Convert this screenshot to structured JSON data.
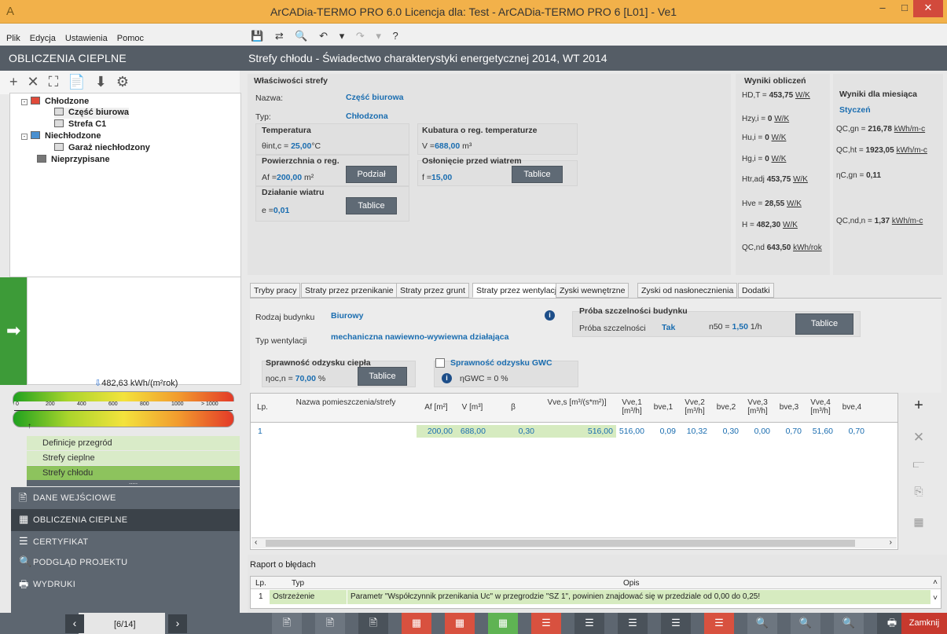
{
  "window": {
    "title": "ArCADia-TERMO PRO 6.0 Licencja dla: Test - ArCADia-TERMO PRO 6 [L01] - Ve1",
    "minimize": "–",
    "maximize": "□",
    "close": "✕"
  },
  "menu": [
    "Plik",
    "Edycja",
    "Ustawienia",
    "Pomoc"
  ],
  "quicktools": [
    "💾",
    "⇄",
    "🔍",
    "↶",
    "▾",
    "↷",
    "▾",
    "?"
  ],
  "left": {
    "header": "OBLICZENIA CIEPLNE",
    "tools": [
      "+",
      "✕",
      "⛶",
      "📄",
      "⬇",
      "⚙"
    ],
    "tree": [
      {
        "label": "Chłodzone",
        "bold": true
      },
      {
        "label": "Część biurowa",
        "bold": true
      },
      {
        "label": "Strefa C1"
      },
      {
        "label": "Niechłodzone"
      },
      {
        "label": "Garaż niechłodzony"
      },
      {
        "label": "Nieprzypisane"
      }
    ],
    "energy": "482,63 kWh/(m²rok)",
    "scale_ticks": [
      "0",
      "200",
      "400",
      "600",
      "800",
      "1000",
      "> 1000"
    ],
    "nav": [
      "Definicje przegród",
      "Strefy cieplne",
      "Strefy chłodu"
    ],
    "dots": ".....",
    "sections": [
      "DANE WEJŚCIOWE",
      "OBLICZENIA CIEPLNE",
      "CERTYFIKAT",
      "PODGLĄD PROJEKTU",
      "WYDRUKI"
    ],
    "page": "[6/14]"
  },
  "main": {
    "header": "Strefy chłodu - Świadectwo charakterystyki energetycznej 2014, WT 2014",
    "props": {
      "title": "Właściwości strefy",
      "nazwa_lbl": "Nazwa:",
      "nazwa": "Część biurowa",
      "typ_lbl": "Typ:",
      "typ": "Chłodzona",
      "temp_title": "Temperatura",
      "temp_sym": "θint,c =",
      "temp_val": "25,00",
      "temp_unit": "°C",
      "kub_title": "Kubatura o reg. temperaturze",
      "kub_sym": "V =",
      "kub_val": "688,00",
      "kub_unit": "m³",
      "pow_title": "Powierzchnia o reg.",
      "pow_sym": "Af =",
      "pow_val": "200,00",
      "pow_unit": "m²",
      "podzial": "Podział",
      "osl_title": "Osłonięcie przed wiatrem",
      "osl_sym": "f =",
      "osl_val": "15,00",
      "tablice": "Tablice",
      "wiatr_title": "Działanie wiatru",
      "wiatr_sym": "e =",
      "wiatr_val": "0,01"
    },
    "results": {
      "title": "Wyniki obliczeń",
      "rows": [
        {
          "sym": "HD,T =",
          "val": "453,75",
          "unit": "W/K"
        },
        {
          "sym": "Hzy,i =",
          "val": "0",
          "unit": "W/K"
        },
        {
          "sym": "Hu,i =",
          "val": "0",
          "unit": "W/K"
        },
        {
          "sym": "Hg,i =",
          "val": "0",
          "unit": "W/K"
        },
        {
          "sym": "Htr,adj",
          "val": "453,75",
          "unit": "W/K"
        },
        {
          "sym": "Hve =",
          "val": "28,55",
          "unit": "W/K"
        },
        {
          "sym": "H =",
          "val": "482,30",
          "unit": "W/K"
        },
        {
          "sym": "QC,nd",
          "val": "643,50",
          "unit": "kWh/rok"
        }
      ]
    },
    "monthly": {
      "title": "Wyniki dla miesiąca",
      "month": "Styczeń",
      "rows": [
        {
          "sym": "QC,gn =",
          "val": "216,78",
          "unit": "kWh/m-c"
        },
        {
          "sym": "QC,ht =",
          "val": "1923,05",
          "unit": "kWh/m-c"
        },
        {
          "sym": "ηC,gn =",
          "val": "0,11",
          "unit": ""
        },
        {
          "sym": "QC,nd,n =",
          "val": "1,37",
          "unit": "kWh/m-c"
        }
      ]
    },
    "tabs": [
      "Tryby pracy",
      "Straty przez przenikanie",
      "Straty przez grunt",
      "Straty przez wentylację",
      "Zyski wewnętrzne",
      "Zyski od nasłonecznienia",
      "Dodatki"
    ],
    "vent": {
      "rodzaj_lbl": "Rodzaj budynku",
      "rodzaj": "Biurowy",
      "typ_lbl": "Typ wentylacji",
      "typ": "mechaniczna nawiewno-wywiewna działająca",
      "proba_title": "Próba szczelności budynku",
      "proba_lbl": "Próba szczelności",
      "proba": "Tak",
      "n50_sym": "n50 =",
      "n50": "1,50",
      "n50_unit": "1/h",
      "tablice": "Tablice",
      "odz_title": "Sprawność odzysku ciepła",
      "odz_sym": "ηoc,n =",
      "odz_val": "70,00",
      "odz_unit": "%",
      "gwc_title": "Sprawność odzysku GWC",
      "gwc_sym": "ηGWC =",
      "gwc_val": "0",
      "gwc_unit": "%"
    },
    "grid": {
      "headers": [
        "Lp.",
        "Nazwa pomieszczenia/strefy",
        "Af [m²]",
        "V [m³]",
        "β",
        "Vve,s [m³/(s*m²)]",
        "Vve,1 [m³/h]",
        "bve,1",
        "Vve,2 [m³/h]",
        "bve,2",
        "Vve,3 [m³/h]",
        "bve,3",
        "Vve,4 [m³/h]",
        "bve,4"
      ],
      "rows": [
        [
          "1",
          "",
          "200,00",
          "688,00",
          "0,30",
          "516,00",
          "516,00",
          "0,09",
          "10,32",
          "0,30",
          "0,00",
          "0,70",
          "51,60",
          "0,70"
        ]
      ]
    },
    "errors": {
      "title": "Raport o błędach",
      "headers": [
        "Lp.",
        "Typ",
        "Opis"
      ],
      "rows": [
        [
          "1",
          "Ostrzeżenie",
          "Parametr \"Współczynnik przenikania Uc\" w przegrodzie \"SZ 1\", powinien znajdować się w przedziale od 0,00 do 0,25!"
        ]
      ]
    },
    "close": "Zamknij"
  }
}
